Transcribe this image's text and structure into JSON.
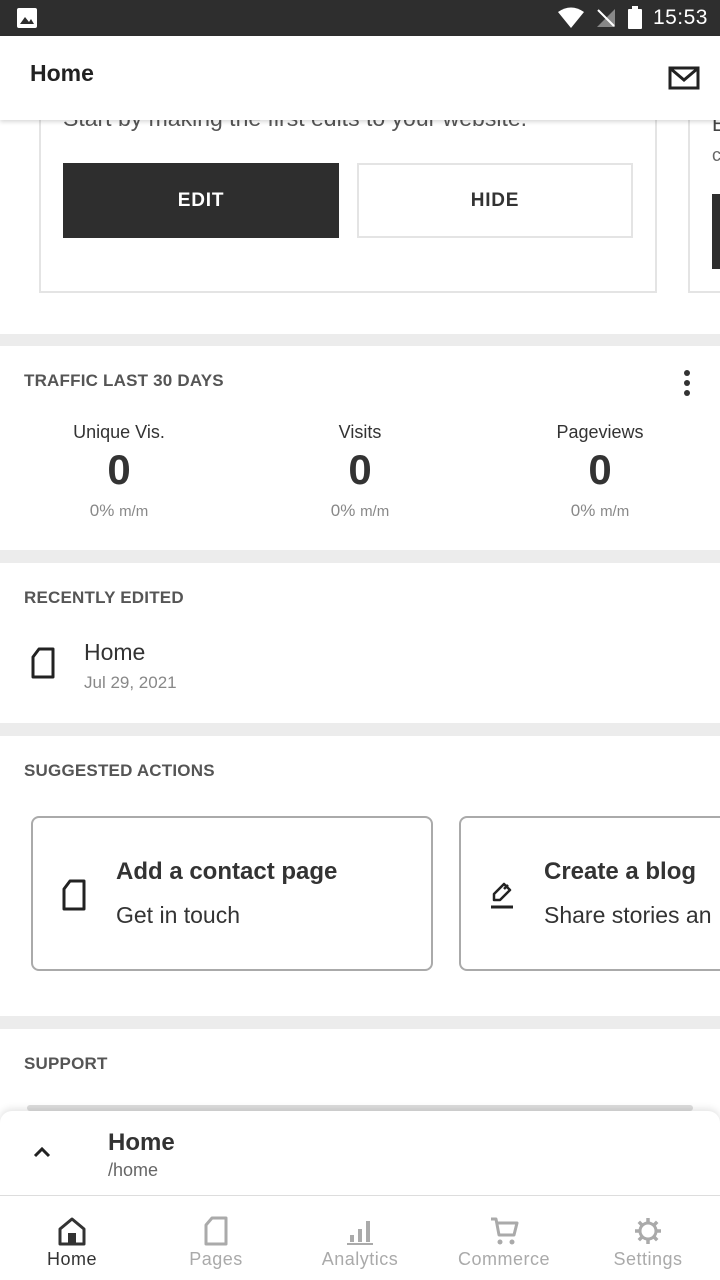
{
  "status_bar": {
    "time": "15:53",
    "icons": [
      "image-icon",
      "wifi-icon",
      "no-signal-icon",
      "battery-icon"
    ]
  },
  "app_bar": {
    "title": "Home",
    "icon": "mail-icon"
  },
  "get_started": {
    "text": "Start by making the first edits to your website.",
    "edit_label": "EDIT",
    "hide_label": "HIDE",
    "next_card_fragment_1": "E",
    "next_card_fragment_2": "c"
  },
  "traffic": {
    "heading": "TRAFFIC LAST 30 DAYS",
    "menu_icon": "more-vert-icon",
    "metrics": [
      {
        "label": "Unique Vis.",
        "value": "0",
        "change": "0%",
        "unit": "m/m"
      },
      {
        "label": "Visits",
        "value": "0",
        "change": "0%",
        "unit": "m/m"
      },
      {
        "label": "Pageviews",
        "value": "0",
        "change": "0%",
        "unit": "m/m"
      }
    ]
  },
  "recently_edited": {
    "heading": "RECENTLY EDITED",
    "items": [
      {
        "title": "Home",
        "date": "Jul 29, 2021",
        "icon": "page-icon"
      }
    ]
  },
  "suggested_actions": {
    "heading": "SUGGESTED ACTIONS",
    "cards": [
      {
        "title": "Add a contact page",
        "subtitle": "Get in touch",
        "icon": "page-icon"
      },
      {
        "title": "Create a blog",
        "subtitle": "Share stories an",
        "icon": "edit-pen-icon"
      }
    ]
  },
  "support": {
    "heading": "SUPPORT"
  },
  "page_selector": {
    "title": "Home",
    "path": "/home",
    "icon": "chevron-up-icon"
  },
  "bottom_nav": {
    "items": [
      {
        "label": "Home",
        "icon": "home-icon",
        "active": true
      },
      {
        "label": "Pages",
        "icon": "pages-icon",
        "active": false
      },
      {
        "label": "Analytics",
        "icon": "analytics-icon",
        "active": false
      },
      {
        "label": "Commerce",
        "icon": "cart-icon",
        "active": false
      },
      {
        "label": "Settings",
        "icon": "gear-icon",
        "active": false
      }
    ]
  },
  "colors": {
    "dark": "#2e2e2e",
    "background": "#ececec",
    "muted_text": "#888888",
    "inactive_nav": "#aaaaaa"
  }
}
